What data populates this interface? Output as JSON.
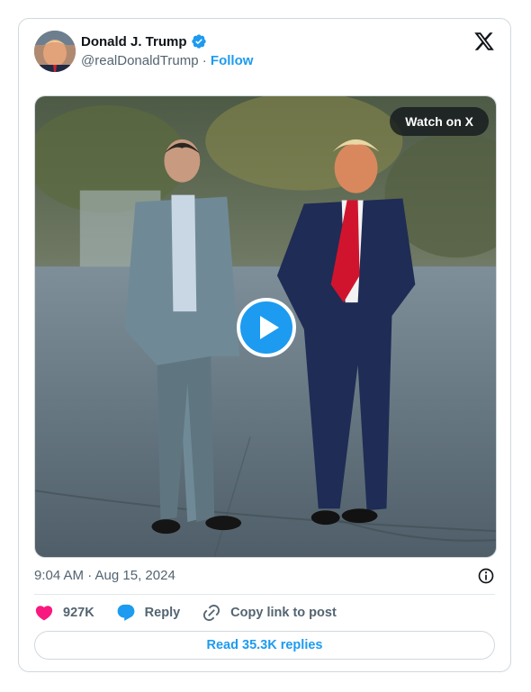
{
  "author": {
    "name": "Donald J. Trump",
    "handle": "@realDonaldTrump",
    "separator": "·",
    "follow_label": "Follow"
  },
  "media": {
    "watch_label": "Watch on X",
    "play_icon": "play-icon"
  },
  "timestamp": "9:04 AM · Aug 15, 2024",
  "actions": {
    "likes_count": "927K",
    "reply_label": "Reply",
    "copy_link_label": "Copy link to post"
  },
  "read_replies_label": "Read 35.3K replies",
  "colors": {
    "accent": "#1d9bf0",
    "like": "#f91880",
    "text": "#0f1419",
    "muted": "#536471",
    "border": "#cfd9de"
  }
}
